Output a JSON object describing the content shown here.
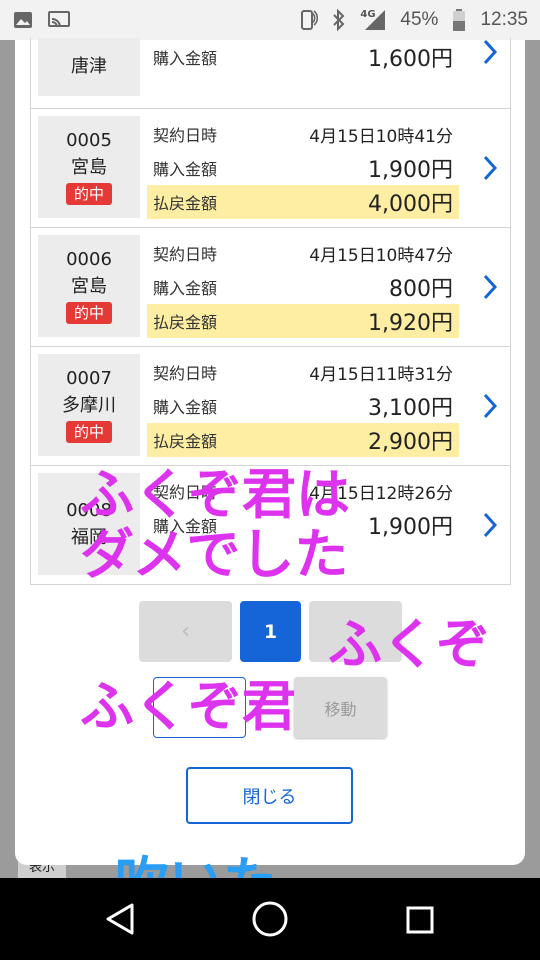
{
  "status_bar": {
    "battery": "45%",
    "time": "12:35",
    "network": "4G"
  },
  "background": {
    "button_label": "表示"
  },
  "rows": [
    {
      "venue": "唐津",
      "purchase_label": "購入金額",
      "purchase": "1,600円"
    },
    {
      "id": "0005",
      "venue": "宮島",
      "badge": "的中",
      "contract_label": "契約日時",
      "contract": "4月15日10時41分",
      "purchase_label": "購入金額",
      "purchase": "1,900円",
      "payout_label": "払戻金額",
      "payout": "4,000円"
    },
    {
      "id": "0006",
      "venue": "宮島",
      "badge": "的中",
      "contract_label": "契約日時",
      "contract": "4月15日10時47分",
      "purchase_label": "購入金額",
      "purchase": "800円",
      "payout_label": "払戻金額",
      "payout": "1,920円"
    },
    {
      "id": "0007",
      "venue": "多摩川",
      "badge": "的中",
      "contract_label": "契約日時",
      "contract": "4月15日11時31分",
      "purchase_label": "購入金額",
      "purchase": "3,100円",
      "payout_label": "払戻金額",
      "payout": "2,900円"
    },
    {
      "id": "0008",
      "venue": "福岡",
      "contract_label": "契約日時",
      "contract": "4月15日12時26分",
      "purchase_label": "購入金額",
      "purchase": "1,900円"
    }
  ],
  "pagination": {
    "prev": "‹",
    "current": "1",
    "move_label": "移動"
  },
  "close_label": "閉じる",
  "overlay": {
    "line1": "ふくぞ君は",
    "line2": "ダメでした",
    "line3": "ふくぞ",
    "line4": "ふくぞ君",
    "line5": "吹いた"
  },
  "colors": {
    "accent": "#1565d8",
    "hit": "#e53935",
    "payout_bg": "#fdeea4",
    "overlay": "#dd33ee",
    "overlay_blue": "#2a9df4"
  },
  "icons": [
    "image-icon",
    "cast-icon",
    "nfc-icon",
    "bluetooth-icon",
    "signal-icon",
    "battery-icon",
    "chevron-right-icon",
    "back-icon",
    "home-icon",
    "recents-icon"
  ]
}
